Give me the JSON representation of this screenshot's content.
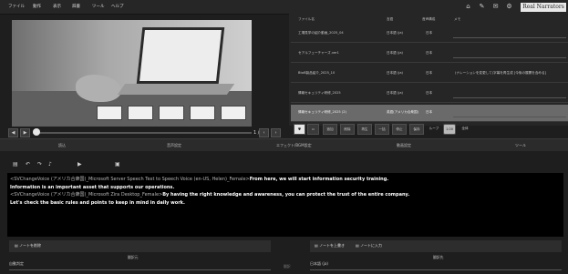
{
  "menu": [
    "ファイル",
    "動作",
    "表示",
    "辞書",
    "ツール",
    "ヘルプ"
  ],
  "topbar_icons": [
    "home-icon",
    "pencil-icon",
    "email-icon",
    "gear-icon"
  ],
  "brand": "Real Narrators",
  "preview": {
    "thumb_count": 5
  },
  "timecode": "1 / 1",
  "file_list": {
    "headers": {
      "name": "ファイル名",
      "lang": "言語",
      "engine": "音声構成",
      "note": "メモ"
    },
    "rows": [
      {
        "name": "工場見学の紹介動画_2025_04",
        "lang": "日本語 (ja)",
        "status": "日本",
        "note": ""
      },
      {
        "name": "セアルフューチャーズ.ver1",
        "lang": "日本語 (ja)",
        "status": "日本",
        "note": ""
      },
      {
        "name": "BtoB製品紹介_2025_10",
        "lang": "日本語 (ja)",
        "status": "日本",
        "note": "(ナレーションを変更して)字幕を再生成 [今後の展開を含める]"
      },
      {
        "name": "情報セキュリティ研修_2025",
        "lang": "日本語 (ja)",
        "status": "日本",
        "note": ""
      },
      {
        "name": "情報セキュリティ研修_2025 (2)",
        "lang": "英語(アメリカ合衆国)",
        "status": "日本",
        "note": ""
      }
    ],
    "selected": 4
  },
  "file_toolbar": {
    "buttons": [
      "追加",
      "削除",
      "再生",
      "一括",
      "停止",
      "保存",
      "ループ",
      "1.00",
      "全体"
    ]
  },
  "tabs": [
    "読込",
    "音声設定",
    "エフェクト/BGM設定",
    "動画設定",
    "ツール"
  ],
  "editor": {
    "lines": [
      {
        "tag": "<SVChangeVoice (アメリカ合衆国)_Microsoft Server Speech Text to Speech Voice (en-US, Helen)_Female>",
        "text": "From here, we will start information security training."
      },
      {
        "tag": "",
        "text": "Information is an important asset that supports our operations."
      },
      {
        "tag": "<SVChangeVoice (アメリカ合衆国)_Microsoft Zira Desktop_Female>",
        "text": "By having the right knowledge and awareness, you can protect the trust of the entire company."
      },
      {
        "tag": "",
        "text": "Let's check the basic rules and points to keep in mind in daily work."
      }
    ]
  },
  "bottom": {
    "left_btn": "ノートを削除",
    "left_label": "翻訳元",
    "left_select": "自動判定",
    "right_btn1": "ノートを上書き",
    "right_btn2": "ノートに入力",
    "right_label": "翻訳先",
    "right_select": "日本語 (ja)",
    "translate_btn": "翻訳"
  }
}
